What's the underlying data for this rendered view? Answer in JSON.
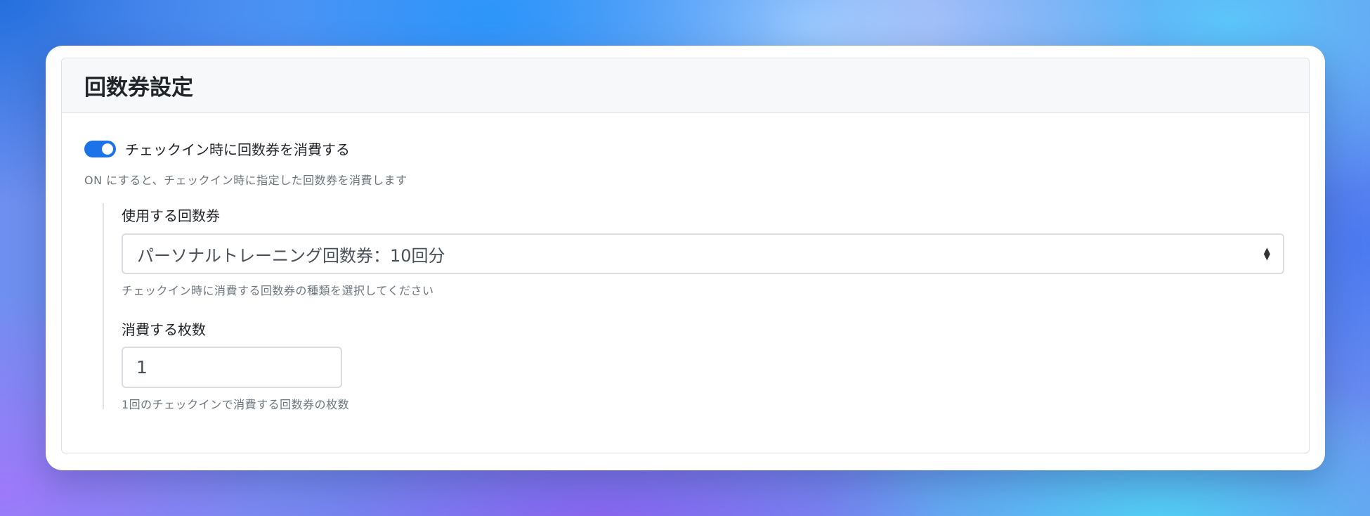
{
  "card": {
    "title": "回数券設定"
  },
  "toggle": {
    "label": "チェックイン時に回数券を消費する",
    "checked": true,
    "help": "ON にすると、チェックイン時に指定した回数券を消費します",
    "color": "#1a73e8"
  },
  "ticket_select": {
    "label": "使用する回数券",
    "selected": "パーソナルトレーニング回数券：10回分",
    "help": "チェックイン時に消費する回数券の種類を選択してください"
  },
  "quantity": {
    "label": "消費する枚数",
    "value": "1",
    "help": "1回のチェックインで消費する回数券の枚数"
  }
}
